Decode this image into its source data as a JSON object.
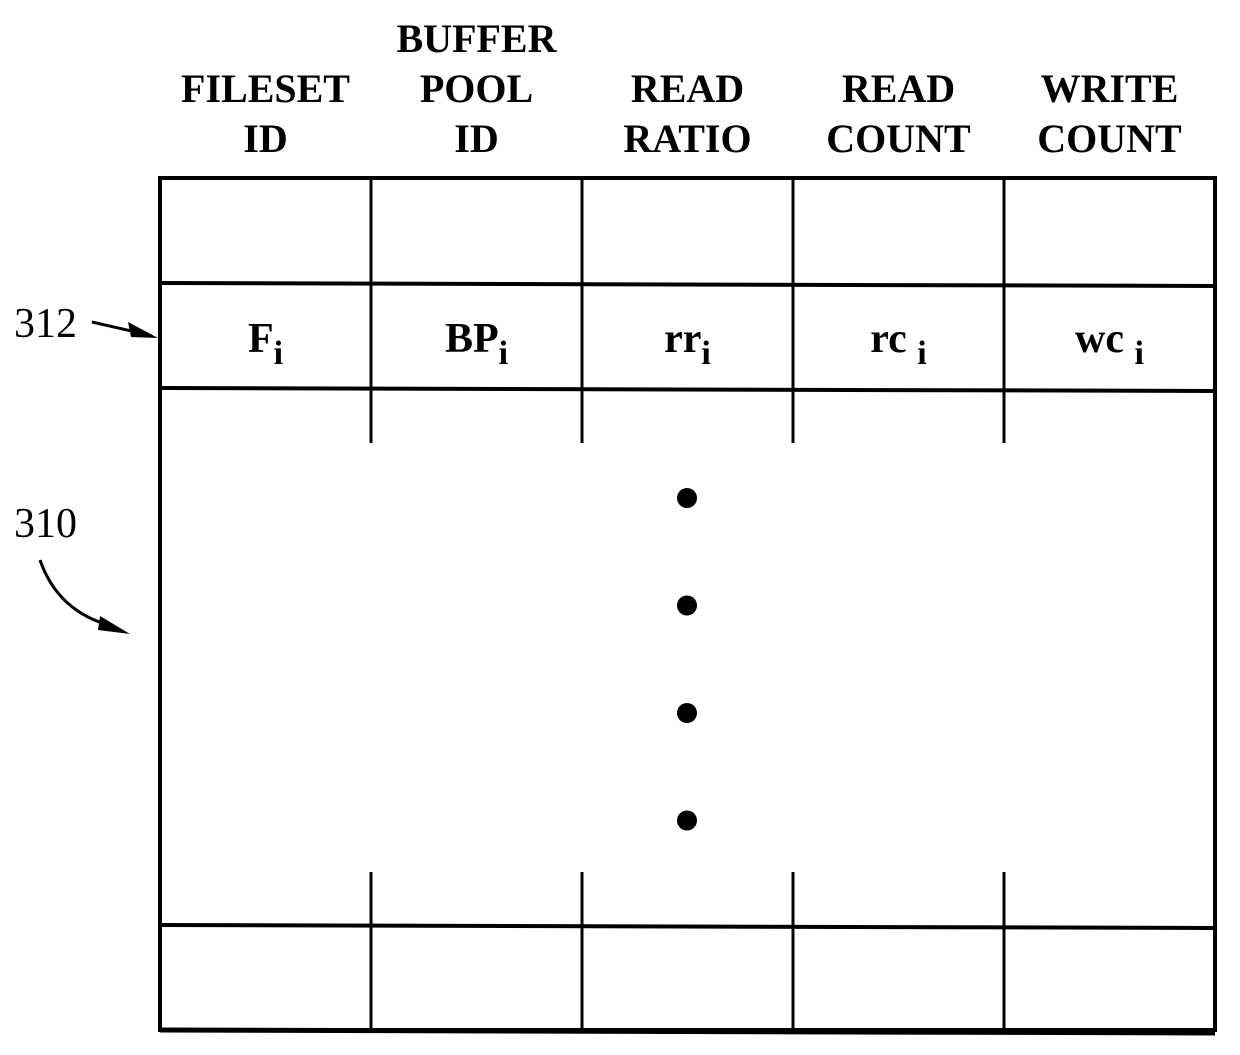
{
  "figure": {
    "columns": [
      {
        "label_lines": [
          "FILESET",
          "ID"
        ],
        "cell_base": "F",
        "cell_sub": "i"
      },
      {
        "label_lines": [
          "BUFFER",
          "POOL",
          "ID"
        ],
        "cell_base": "BP",
        "cell_sub": "i"
      },
      {
        "label_lines": [
          "READ",
          "RATIO"
        ],
        "cell_base": "rr",
        "cell_sub": "i"
      },
      {
        "label_lines": [
          "READ",
          "COUNT"
        ],
        "cell_base": "rc ",
        "cell_sub": "i"
      },
      {
        "label_lines": [
          "WRITE",
          "COUNT"
        ],
        "cell_base": "wc ",
        "cell_sub": "i"
      }
    ],
    "reference_numerals": {
      "entry_row": "312",
      "table": "310"
    },
    "ellipsis_dot_count": 4,
    "colors": {
      "ink": "#000000",
      "paper": "#ffffff"
    }
  }
}
